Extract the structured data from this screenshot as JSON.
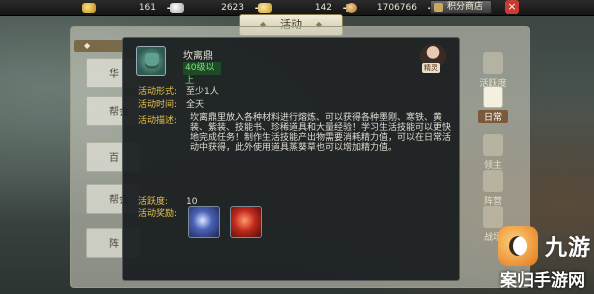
{
  "currency": [
    {
      "icon": "gold-ingot-icon",
      "value": "161"
    },
    {
      "icon": "silver-icon",
      "value": "2623"
    },
    {
      "icon": "ingot-icon",
      "value": "142"
    },
    {
      "icon": "copper-coin-icon",
      "value": "1706766"
    }
  ],
  "shop_label": "积分商店",
  "close_label": "×",
  "tab_title": "活动",
  "left_list": [
    "华",
    "帮会",
    "百",
    "帮会",
    "阵"
  ],
  "right_tabs": [
    {
      "label": "活跃度",
      "active": false
    },
    {
      "label": "日常",
      "active": true
    },
    {
      "label": "领主",
      "active": false
    },
    {
      "label": "阵营",
      "active": false
    },
    {
      "label": "战场",
      "active": false
    }
  ],
  "popup": {
    "item_name": "坎离鼎",
    "level": "40级以上",
    "npc_label": "精灵",
    "form_label": "活动形式:",
    "form_value": "至少1人",
    "time_label": "活动时间:",
    "time_value": "全天",
    "desc_label": "活动描述:",
    "desc_value": "坎离鼎里放入各种材料进行熔炼、可以获得各种墨刚、寒铁、黄装、紫装、技能书、珍稀道具和大量经验！学习生活技能可以更快地完成任务！制作生活技能产出物需要消耗精力值，可以在日常活动中获得，此外使用道具蒸葵草也可以增加精力值。",
    "active_label": "活跃度:",
    "active_value": "10",
    "reward_label": "活动奖励:"
  },
  "watermark": {
    "logo": "九游",
    "site": "案归手游网"
  },
  "colors": {
    "label_gold": "#e8c24a",
    "level_green": "#7ee07a",
    "popup_bg": "#1a1e20"
  }
}
